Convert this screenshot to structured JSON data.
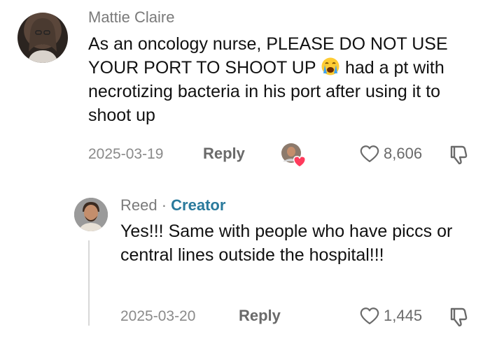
{
  "comments": [
    {
      "username": "Mattie Claire",
      "text_before_emoji": "As an oncology nurse, PLEASE DO NOT USE YOUR PORT TO SHOOT UP ",
      "emoji_icon": "crying-face-icon",
      "text_after_emoji": " had a pt with necrotizing bacteria in his port after using it to shoot up",
      "date": "2025-03-19",
      "reply_label": "Reply",
      "like_count": "8,606"
    }
  ],
  "reply": {
    "username": "Reed",
    "separator": "·",
    "badge": "Creator",
    "text": "Yes!!! Same with people who have piccs or central lines outside the hospital!!!",
    "date": "2025-03-20",
    "reply_label": "Reply",
    "like_count": "1,445"
  },
  "colors": {
    "creator_badge": "#2a7a9c",
    "meta_gray": "#8a8a8a",
    "like_heart_red": "#ff3b5c"
  }
}
